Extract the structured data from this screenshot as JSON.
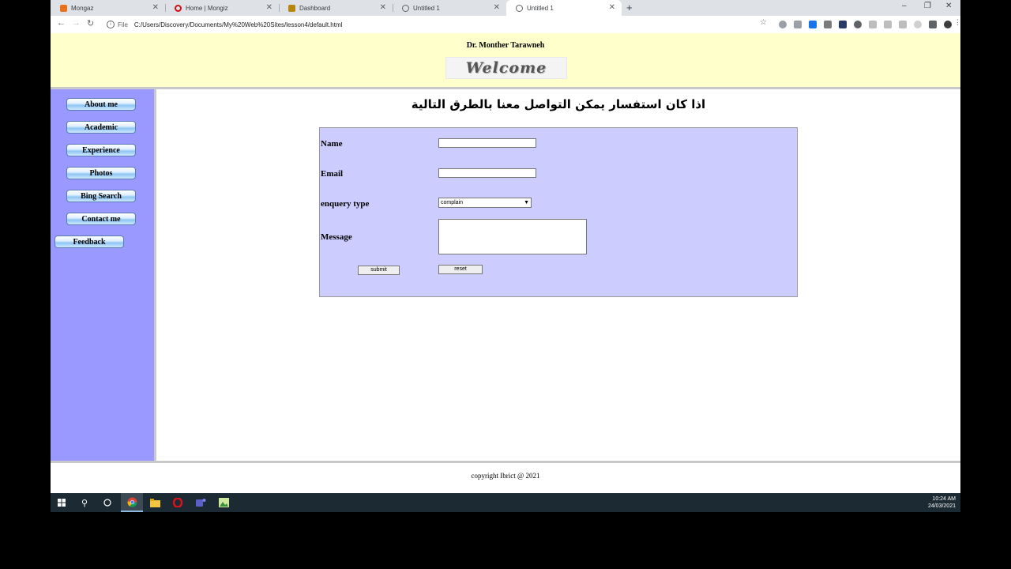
{
  "browser": {
    "tabs": [
      {
        "title": "Mongaz",
        "icon": "mongaz-icon",
        "active": false
      },
      {
        "title": "Home | Mongiz",
        "icon": "opera-circle-icon",
        "active": false
      },
      {
        "title": "Dashboard",
        "icon": "dashboard-icon",
        "active": false
      },
      {
        "title": "Untitled 1",
        "icon": "globe-icon",
        "active": false
      },
      {
        "title": "Untitled 1",
        "icon": "globe-icon",
        "active": true
      }
    ],
    "new_tab": "+",
    "close_glyph": "✕",
    "window_controls": {
      "minimize": "–",
      "restore": "❐",
      "close": "✕"
    },
    "nav": {
      "back": "←",
      "forward": "→",
      "reload": "↻"
    },
    "address": {
      "scheme_label": "File",
      "url": "C:/Users/Discovery/Documents/My%20Web%20Sites/lesson4/default.html"
    }
  },
  "site": {
    "author": "Dr. Monther Tarawneh",
    "welcome_logo": "Welcome",
    "sidebar": [
      {
        "label": "About me"
      },
      {
        "label": "Academic"
      },
      {
        "label": "Experience"
      },
      {
        "label": "Photos"
      },
      {
        "label": "Bing Search"
      },
      {
        "label": "Contact me"
      },
      {
        "label": "Feedback"
      }
    ],
    "heading": "اذا كان استفسار يمكن التواصل معنا بالطرق التالية",
    "form": {
      "name_label": "Name",
      "email_label": "Email",
      "enquiry_label": "enquery type",
      "enquiry_value": "complain",
      "message_label": "Message",
      "submit_label": "submit",
      "reset_label": "reset"
    },
    "footer": "copyright Ibrict @ 2021"
  },
  "taskbar": {
    "time": "10:24 AM",
    "date": "24/03/2021"
  },
  "colors": {
    "header_bg": "#ffffcc",
    "sidebar_bg": "#9999ff",
    "form_bg": "#ccccff",
    "taskbar_bg": "#1c2a33"
  }
}
